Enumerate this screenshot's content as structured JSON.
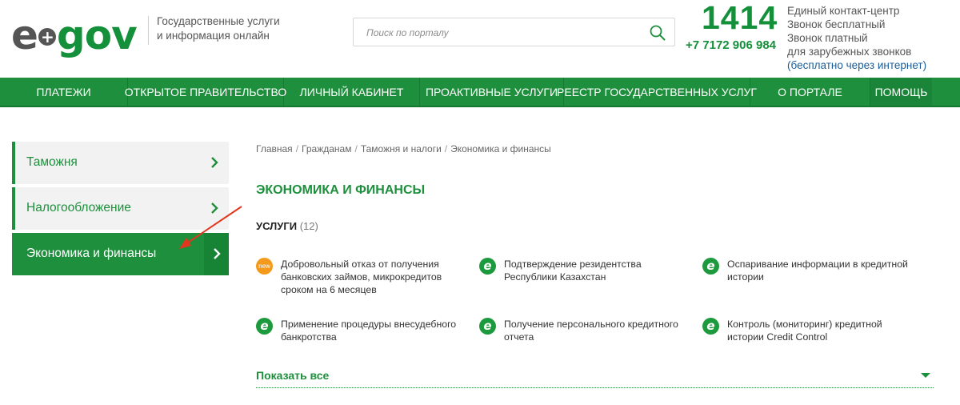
{
  "header": {
    "logo": {
      "part_e": "e",
      "plus": "+",
      "part_gov": "gov"
    },
    "tagline_line1": "Государственные услуги",
    "tagline_line2": "и информация онлайн",
    "search_placeholder": "Поиск по порталу",
    "contact": {
      "short_number": "1414",
      "long_number": "+7 7172 906 984",
      "line1": "Единый контакт-центр",
      "line2": "Звонок бесплатный",
      "line3": "Звонок платный",
      "line4": "для зарубежных звонков",
      "line5": "(бесплатно через интернет)"
    }
  },
  "nav": {
    "items": [
      {
        "label": "Платежи"
      },
      {
        "label": "Открытое правительство"
      },
      {
        "label": "Личный кабинет"
      },
      {
        "label": "Проактивные услуги"
      },
      {
        "label": "Реестр государственных услуг"
      },
      {
        "label": "О портале"
      },
      {
        "label": "Помощь"
      }
    ]
  },
  "sidebar": {
    "items": [
      {
        "label": "Таможня",
        "active": false
      },
      {
        "label": "Налогообложение",
        "active": false
      },
      {
        "label": "Экономика и финансы",
        "active": true
      }
    ]
  },
  "breadcrumb": [
    "Главная",
    "Гражданам",
    "Таможня и налоги",
    "Экономика и финансы"
  ],
  "page_title": "Экономика и финансы",
  "services": {
    "heading": "Услуги",
    "count": "(12)",
    "items": [
      {
        "badge": "new",
        "text": "Добровольный отказ от получения банковских займов, микрокредитов сроком на 6 месяцев"
      },
      {
        "badge": "e",
        "text": "Подтверждение резидентства Республики Казахстан"
      },
      {
        "badge": "e",
        "text": "Оспаривание информации в кредитной истории"
      },
      {
        "badge": "e",
        "text": "Применение процедуры внесудебного банкротства"
      },
      {
        "badge": "e",
        "text": "Получение персонального кредитного отчета"
      },
      {
        "badge": "e",
        "text": "Контроль (мониторинг) кредитной истории Credit Control"
      }
    ],
    "show_all": "Показать все"
  },
  "colors": {
    "brand_green": "#1e8f3c",
    "new_badge": "#f39a1d",
    "link_blue": "#1a5d99",
    "arrow_red": "#e2371f"
  }
}
